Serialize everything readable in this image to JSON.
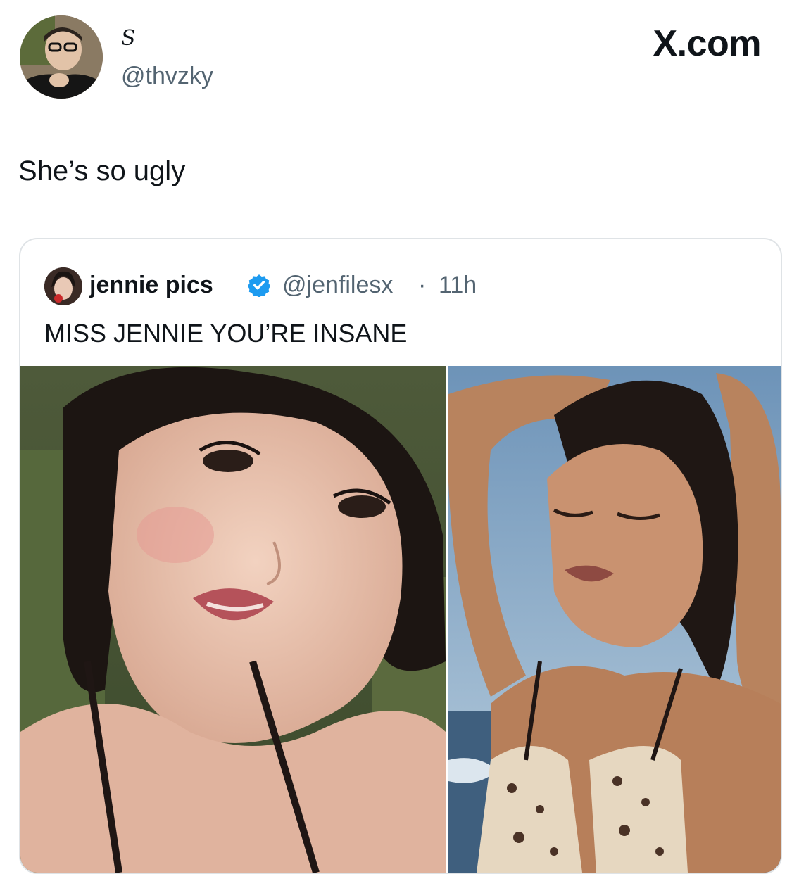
{
  "post": {
    "display_name": "𝑆",
    "handle": "@thvzky",
    "brand": "X.com",
    "text": "She’s so ugly",
    "avatar_icon": "user-avatar-photo"
  },
  "quoted_post": {
    "name": "jennie pics",
    "handle": "@jenfilesx",
    "separator": "·",
    "time": "11h",
    "text": "MISS JENNIE YOU’RE INSANE",
    "verified_icon": "verified-badge-icon",
    "verified_color": "#1d9bf0",
    "media": [
      {
        "icon": "photo-closeup-portrait"
      },
      {
        "icon": "photo-beach-portrait"
      }
    ]
  },
  "colors": {
    "text_primary": "#0f1419",
    "text_secondary": "#536471",
    "card_border": "#dfe3e6"
  }
}
